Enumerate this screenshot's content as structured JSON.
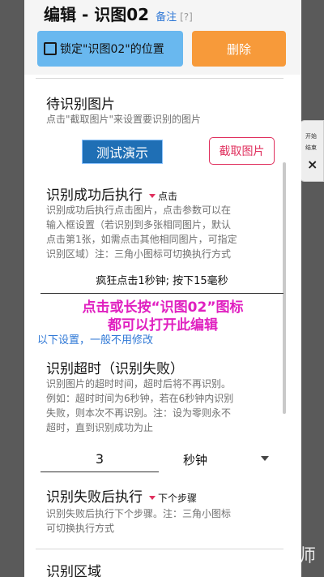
{
  "header": {
    "title": "编辑 - 识图02",
    "remark_link": "备注",
    "help_link": "[?]"
  },
  "actions": {
    "lock_label": "锁定\"识图02\"的位置",
    "delete_label": "删除"
  },
  "image_section": {
    "title": "待识别图片",
    "desc": "点击\"截取图片\"来设置要识别的图片",
    "demo_button": "测试演示",
    "capture_button": "截取图片"
  },
  "success_section": {
    "title": "识别成功后执行",
    "mode": "点击",
    "desc_lines": [
      "识别成功后执行点击图片，点击参数可以在",
      "输入框设置（若识别到多张相同图片，默认",
      "点击第1张，如需点击其他相同图片，可指定",
      "识别区域）注：三角小图标可切换执行方式"
    ],
    "param_value": "疯狂点击1秒钟; 按下15毫秒"
  },
  "overlay_hint": {
    "line1": "点击或长按“识图02”图标",
    "line2": "都可以打开此编辑"
  },
  "advanced_label": "以下设置，一般不用修改",
  "timeout_section": {
    "title": "识别超时（识别失败）",
    "desc_lines": [
      "识别图片的超时时间，超时后将不再识别。",
      "例如：超时时间为6秒钟，若在6秒钟内识别",
      "失败，则本次不再识别。注：设为零则永不",
      "超时，直到识别成功为止"
    ],
    "value": "3",
    "unit": "秒钟"
  },
  "fail_section": {
    "title": "识别失败后执行",
    "mode": "下个步骤",
    "desc_lines": [
      "识别失败后执行下个步骤。注：三角小图标",
      "可切换执行方式"
    ]
  },
  "region_section": {
    "title": "识别区域"
  },
  "edge_widget": {
    "small1": "开始",
    "small2": "结束",
    "mark": "⨯"
  },
  "corner_char": "师",
  "colors": {
    "accent_blue": "#69b8ef",
    "delete_orange": "#f79a3a",
    "pink": "#e0305e",
    "overlay_magenta": "#e020c0",
    "link_blue": "#2f78d6"
  }
}
